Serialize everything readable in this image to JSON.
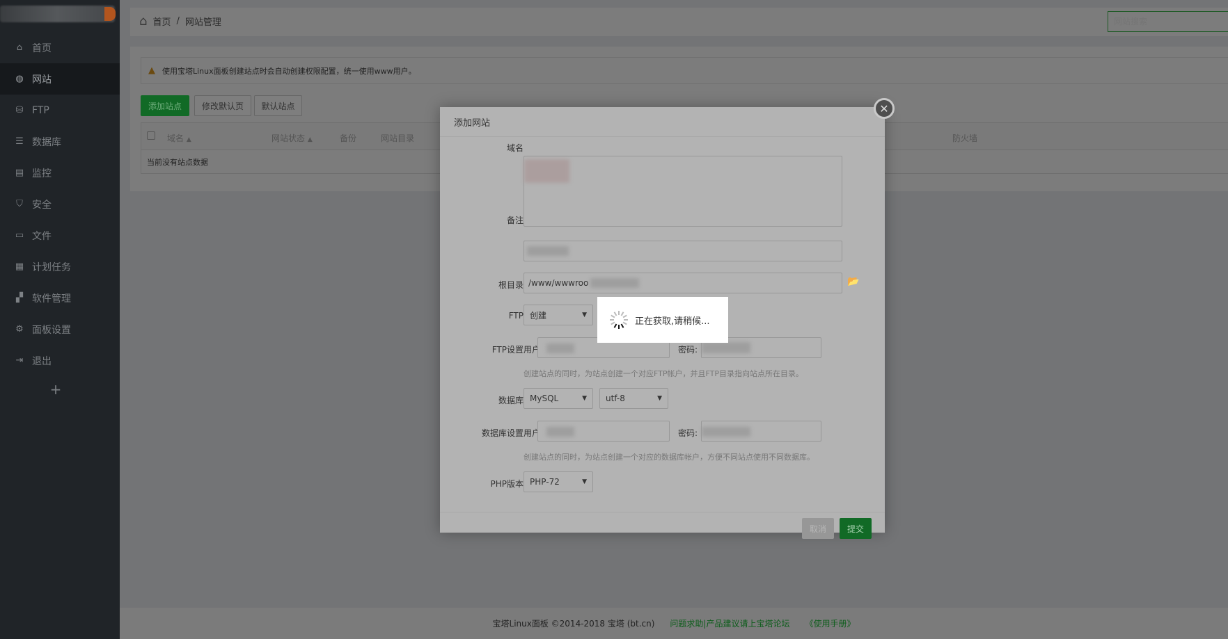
{
  "sidebar": {
    "items": [
      {
        "label": "首页",
        "icon": "home-icon"
      },
      {
        "label": "网站",
        "icon": "globe-icon",
        "active": true
      },
      {
        "label": "FTP",
        "icon": "ftp-icon"
      },
      {
        "label": "数据库",
        "icon": "database-icon"
      },
      {
        "label": "监控",
        "icon": "monitor-icon"
      },
      {
        "label": "安全",
        "icon": "shield-icon"
      },
      {
        "label": "文件",
        "icon": "folder-icon"
      },
      {
        "label": "计划任务",
        "icon": "calendar-icon"
      },
      {
        "label": "软件管理",
        "icon": "grid-icon"
      },
      {
        "label": "面板设置",
        "icon": "gear-icon"
      },
      {
        "label": "退出",
        "icon": "logout-icon"
      }
    ],
    "add": "+"
  },
  "header": {
    "breadcrumb": [
      "首页",
      "网站管理"
    ],
    "separator": "/",
    "search_placeholder": "网站搜索"
  },
  "main": {
    "alert": "使用宝塔Linux面板创建站点时会自动创建权限配置，统一使用www用户。",
    "buttons": [
      "添加站点",
      "修改默认页",
      "默认站点"
    ],
    "columns": [
      "域名",
      "网站状态",
      "备份",
      "网站目录",
      "防火墙"
    ],
    "empty": "当前没有站点数据"
  },
  "modal": {
    "title": "添加网站",
    "labels": {
      "domain": "域名",
      "remark": "备注",
      "root": "根目录",
      "ftp": "FTP",
      "ftp_settings": "FTP设置",
      "db": "数据库",
      "db_settings": "数据库设置",
      "php": "PHP版本"
    },
    "root_value": "/www/wwwroo",
    "ftp_select": "创建",
    "user_label": "用户",
    "password_label": "密码:",
    "ftp_hint": "创建站点的同时，为站点创建一个对应FTP帐户，并且FTP目录指向站点所在目录。",
    "db_select": "MySQL",
    "charset_select": "utf-8",
    "db_hint": "创建站点的同时，为站点创建一个对应的数据库帐户，方便不同站点使用不同数据库。",
    "php_select": "PHP-72",
    "cancel": "取消",
    "submit": "提交"
  },
  "loading": {
    "text": "正在获取,请稍候..."
  },
  "footer": {
    "copyright": "宝塔Linux面板 ©2014-2018 宝塔 (bt.cn)",
    "forum": "问题求助|产品建议请上宝塔论坛",
    "manual": "《使用手册》"
  },
  "colors": {
    "accent": "#20a53a",
    "sidebar": "#30373d"
  }
}
